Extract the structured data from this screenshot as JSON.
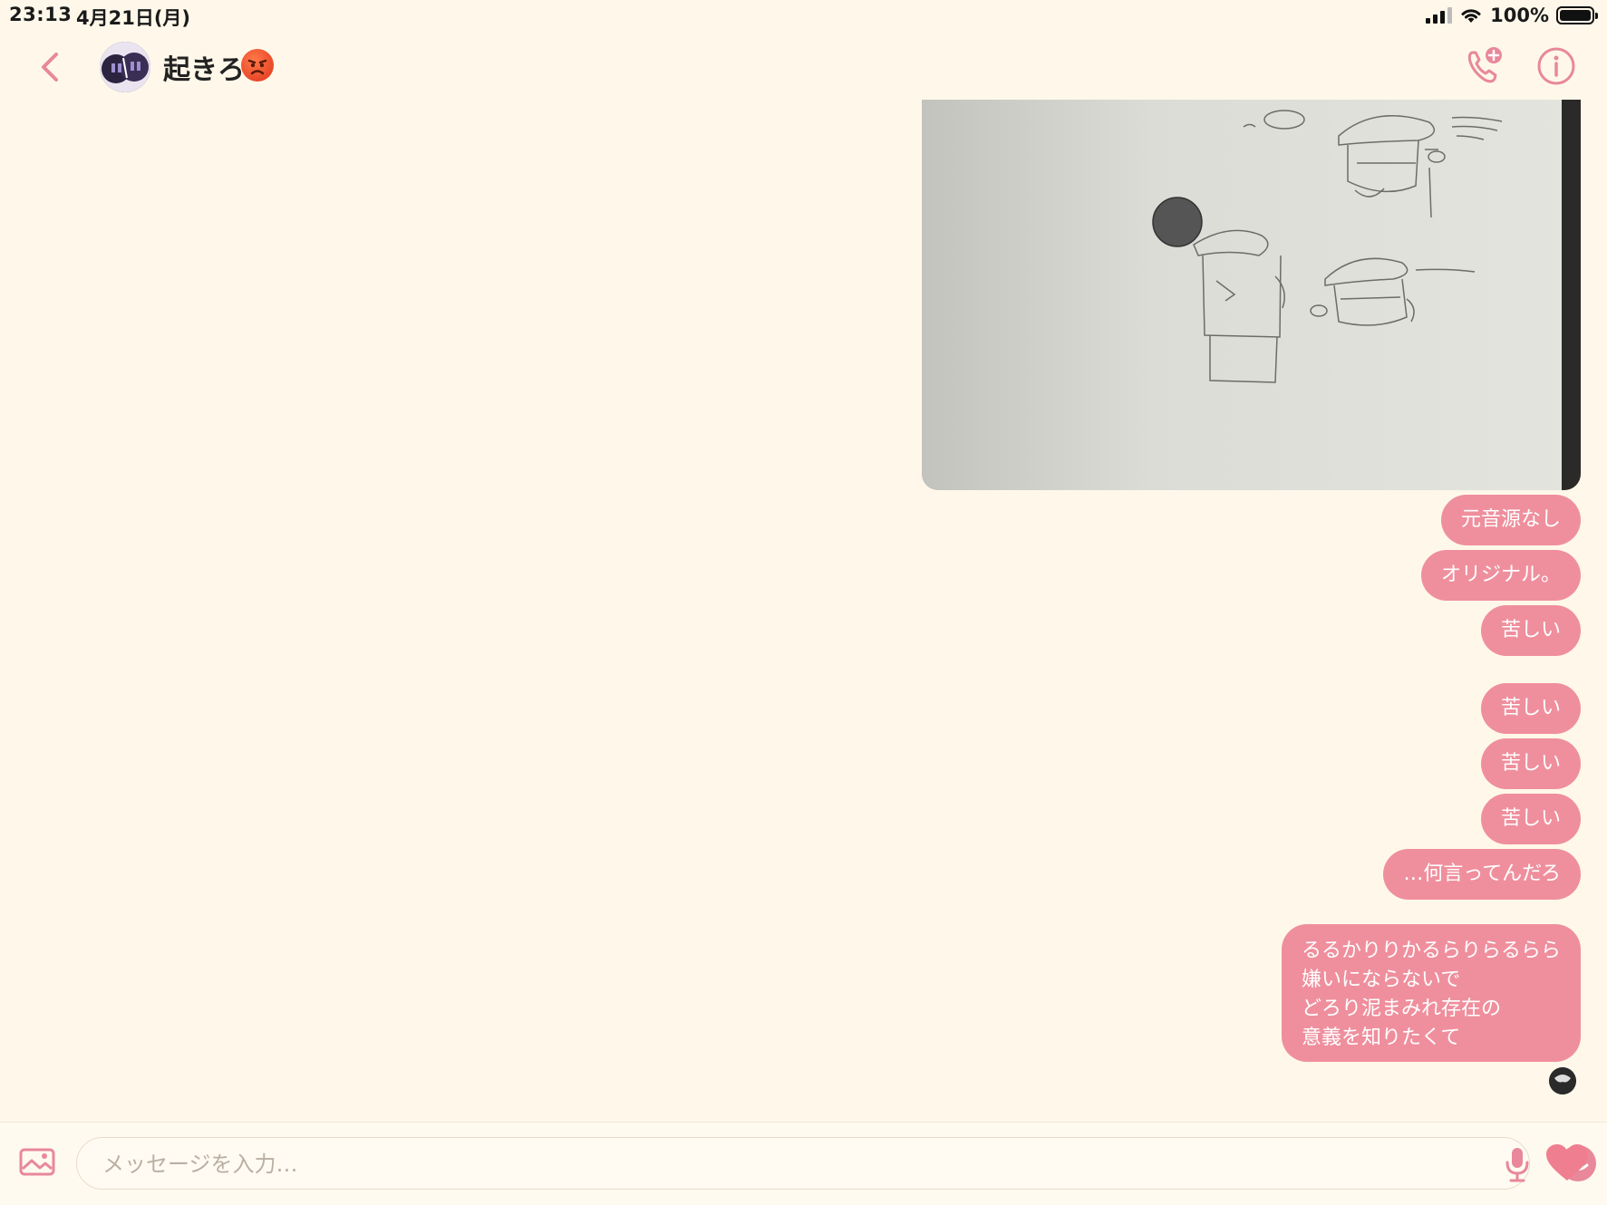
{
  "status_bar": {
    "time": "23:13",
    "date": "4月21日(月)",
    "battery": "100%",
    "battery_level": 1.0
  },
  "header": {
    "title": "起きろ",
    "title_emoji": "angry-face-icon",
    "back_icon": "chevron-left-icon",
    "call_icon": "phone-add-icon",
    "info_icon": "info-icon"
  },
  "messages": [
    {
      "type": "image",
      "description_icon": "photo"
    },
    {
      "type": "text",
      "text": "元音源なし"
    },
    {
      "type": "text",
      "text": "オリジナル。"
    },
    {
      "type": "text",
      "text": "苦しい"
    },
    {
      "type": "text",
      "text": "苦しい"
    },
    {
      "type": "text",
      "text": "苦しい"
    },
    {
      "type": "text",
      "text": "苦しい"
    },
    {
      "type": "text",
      "text": "…何言ってんだろ"
    },
    {
      "type": "text",
      "text": "るるかりりかるらりらるらら\n嫌いにならないで\nどろり泥まみれ存在の\n意義を知りたくて"
    }
  ],
  "composer": {
    "placeholder": "メッセージを入力…",
    "value": ""
  },
  "colors": {
    "background": "#fff8ea",
    "accent": "#ef8f9d",
    "bubble_text": "#ffffff"
  }
}
